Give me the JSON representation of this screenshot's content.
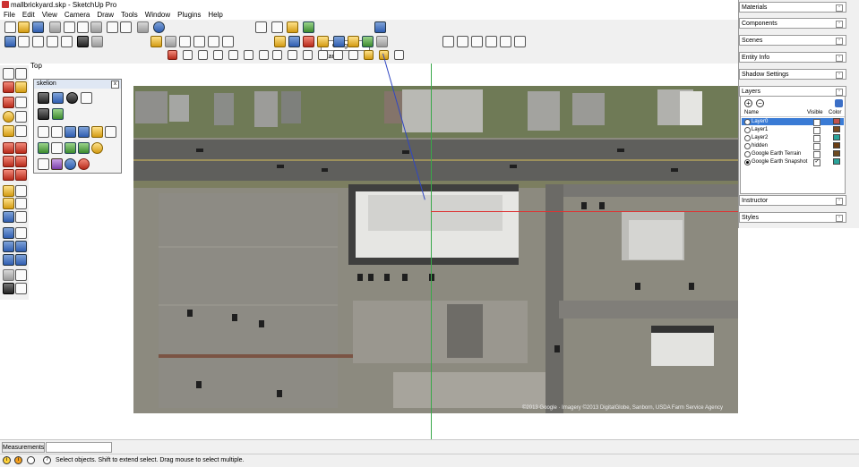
{
  "window": {
    "title": "mallbrickyard.skp - SketchUp Pro"
  },
  "menu": [
    "File",
    "Edit",
    "View",
    "Camera",
    "Draw",
    "Tools",
    "Window",
    "Plugins",
    "Help"
  ],
  "toolbar": {
    "google_earth_select": {
      "checkmark": "✓",
      "value": "Google Earth"
    }
  },
  "viewport": {
    "scene_label": "Top",
    "imagery_copyright": "©2013 Google · Imagery ©2013 DigitalGlobe, Sanborn, USDA Farm Service Agency"
  },
  "skelion": {
    "title": "skelion",
    "close": "x"
  },
  "tray": {
    "panels_top": [
      "Materials",
      "Components",
      "Scenes",
      "Entity Info",
      "Shadow Settings"
    ],
    "layers": {
      "title": "Layers",
      "add": "+",
      "remove": "−",
      "columns": {
        "name": "Name",
        "visible": "Visible",
        "color": "Color"
      },
      "rows": [
        {
          "name": "Layer0",
          "active": false,
          "visible": true,
          "color": "#c0504d",
          "selected": true
        },
        {
          "name": "Layer1",
          "active": false,
          "visible": false,
          "color": "#7a4a1f",
          "selected": false
        },
        {
          "name": "Layer2",
          "active": false,
          "visible": false,
          "color": "#2aa39a",
          "selected": false
        },
        {
          "name": "hidden",
          "active": false,
          "visible": false,
          "color": "#6b3d12",
          "selected": false
        },
        {
          "name": "Google Earth Terrain",
          "active": false,
          "visible": false,
          "color": "#6e4a20",
          "selected": false
        },
        {
          "name": "Google Earth Snapshot",
          "active": true,
          "visible": true,
          "color": "#2aa39a",
          "selected": false
        }
      ]
    },
    "panels_bottom": [
      "Instructor",
      "Styles"
    ],
    "pin_glyph": "▫"
  },
  "measurements": {
    "label": "Measurements",
    "value": ""
  },
  "status": {
    "text": "Select objects. Shift to extend select. Drag mouse to select multiple."
  }
}
